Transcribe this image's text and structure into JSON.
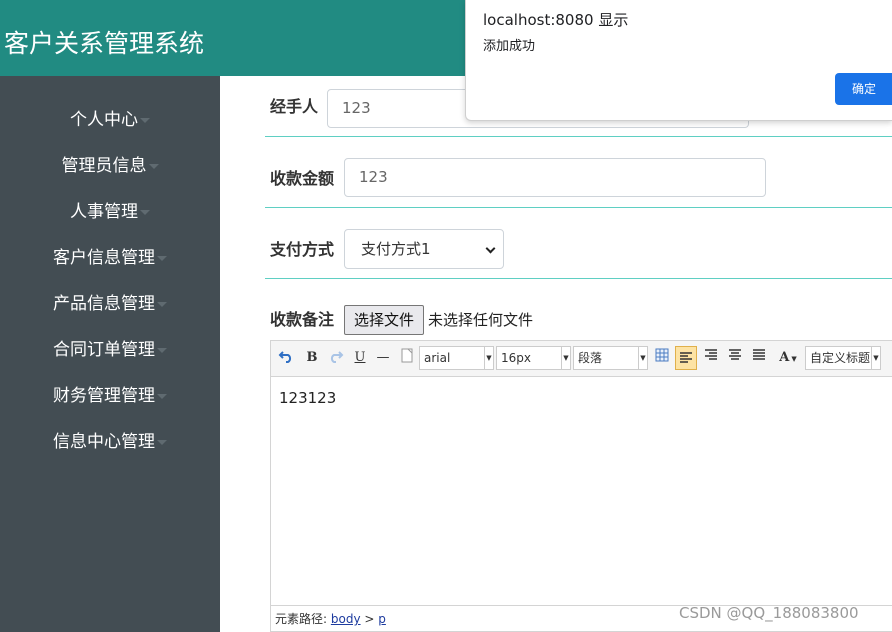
{
  "header": {
    "title": "客户关系管理系统"
  },
  "sidebar": {
    "items": [
      {
        "label": "个人中心"
      },
      {
        "label": "管理员信息"
      },
      {
        "label": "人事管理"
      },
      {
        "label": "客户信息管理"
      },
      {
        "label": "产品信息管理"
      },
      {
        "label": "合同订单管理"
      },
      {
        "label": "财务管理管理"
      },
      {
        "label": "信息中心管理"
      }
    ]
  },
  "form": {
    "handler": {
      "label": "经手人",
      "value": "123"
    },
    "amount": {
      "label": "收款金额",
      "value": "123"
    },
    "payment": {
      "label": "支付方式",
      "selected": "支付方式1"
    },
    "remark": {
      "label": "收款备注",
      "file_button": "选择文件",
      "file_status": "未选择任何文件"
    }
  },
  "editor": {
    "toolbar": {
      "undo_icon": "undo-icon",
      "bold": "B",
      "redo_icon": "redo-icon",
      "underline": "U",
      "hr": "—",
      "font_family": "arial",
      "font_size": "16px",
      "paragraph": "段落",
      "text_color": "A",
      "custom_title": "自定义标题"
    },
    "content": "123123",
    "path_label": "元素路径:",
    "path": [
      "body",
      "p"
    ],
    "path_sep": ">"
  },
  "dialog": {
    "title": "localhost:8080 显示",
    "message": "添加成功",
    "ok": "确定"
  },
  "watermark": "CSDN @QQ_188083800",
  "colors": {
    "header": "#218b82",
    "sidebar": "#434d53",
    "divider": "#5fcfc3",
    "primary_button": "#1a73e8"
  }
}
